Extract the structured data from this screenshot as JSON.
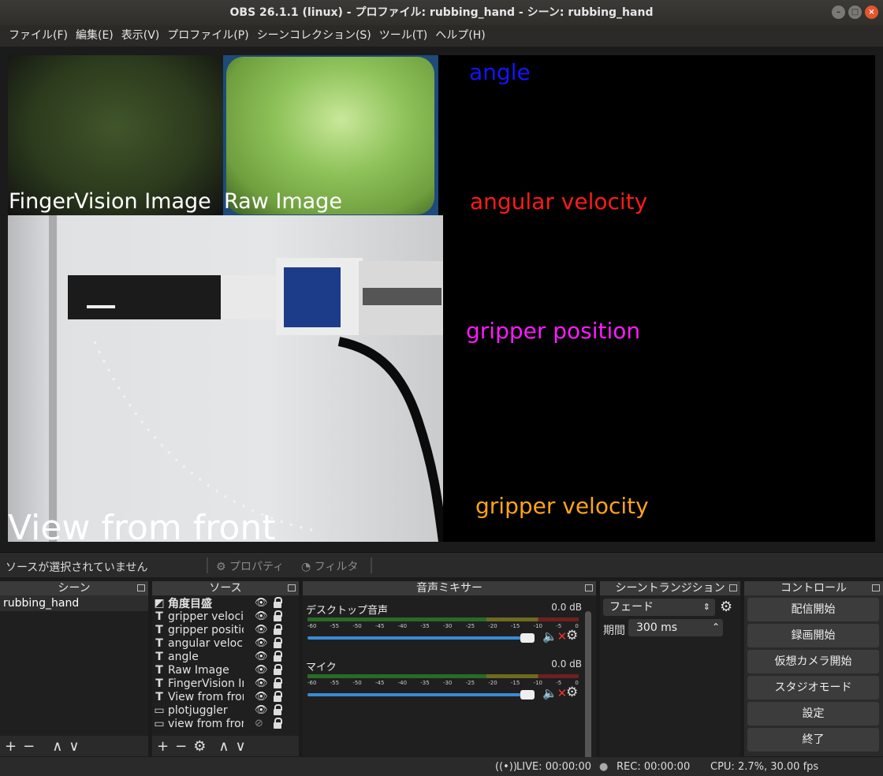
{
  "window": {
    "title": "OBS 26.1.1 (linux) - プロファイル: rubbing_hand - シーン: rubbing_hand"
  },
  "menu": [
    "ファイル(F)",
    "編集(E)",
    "表示(V)",
    "プロファイル(P)",
    "シーンコレクション(S)",
    "ツール(T)",
    "ヘルプ(H)"
  ],
  "preview": {
    "fv_label": "FingerVision Image",
    "raw_label": "Raw Image",
    "front_label": "View from front",
    "plot_labels": {
      "angle": "angle",
      "angular_velocity": "angular velocity",
      "gripper_position": "gripper position",
      "gripper_velocity": "gripper velocity"
    },
    "colors": {
      "angle": "#1414ff",
      "angular_velocity": "#ff1a1a",
      "gripper_position": "#ff1aff",
      "gripper_velocity": "#ffa41a"
    }
  },
  "toolbar": {
    "no_source": "ソースが選択されていません",
    "properties": "プロパティ",
    "filters": "フィルタ"
  },
  "scenes": {
    "title": "シーン",
    "items": [
      "rubbing_hand"
    ]
  },
  "sources": {
    "title": "ソース",
    "items": [
      {
        "name": "角度目盛",
        "icon": "image-icon",
        "visible": true
      },
      {
        "name": "gripper velocit",
        "icon": "text-icon",
        "visible": true
      },
      {
        "name": "gripper positio",
        "icon": "text-icon",
        "visible": true
      },
      {
        "name": "angular velocit",
        "icon": "text-icon",
        "visible": true
      },
      {
        "name": "angle",
        "icon": "text-icon",
        "visible": true
      },
      {
        "name": "Raw Image",
        "icon": "text-icon",
        "visible": true
      },
      {
        "name": "FingerVision Im",
        "icon": "text-icon",
        "visible": true
      },
      {
        "name": "View from fron",
        "icon": "text-icon",
        "visible": true
      },
      {
        "name": "plotjuggler",
        "icon": "window-icon",
        "visible": true
      },
      {
        "name": "view from fron",
        "icon": "window-icon",
        "visible": false
      }
    ]
  },
  "mixer": {
    "title": "音声ミキサー",
    "ticks": [
      "-60",
      "-55",
      "-50",
      "-45",
      "-40",
      "-35",
      "-30",
      "-25",
      "-20",
      "-15",
      "-10",
      "-5",
      "0"
    ],
    "channels": [
      {
        "name": "デスクトップ音声",
        "db": "0.0 dB"
      },
      {
        "name": "マイク",
        "db": "0.0 dB"
      }
    ]
  },
  "transitions": {
    "title": "シーントランジション",
    "selected": "フェード",
    "duration_label": "期間",
    "duration": "300 ms"
  },
  "controls": {
    "title": "コントロール",
    "buttons": [
      "配信開始",
      "録画開始",
      "仮想カメラ開始",
      "スタジオモード",
      "設定",
      "終了"
    ]
  },
  "status": {
    "live": "LIVE: 00:00:00",
    "rec": "REC: 00:00:00",
    "cpu": "CPU: 2.7%, 30.00 fps"
  }
}
